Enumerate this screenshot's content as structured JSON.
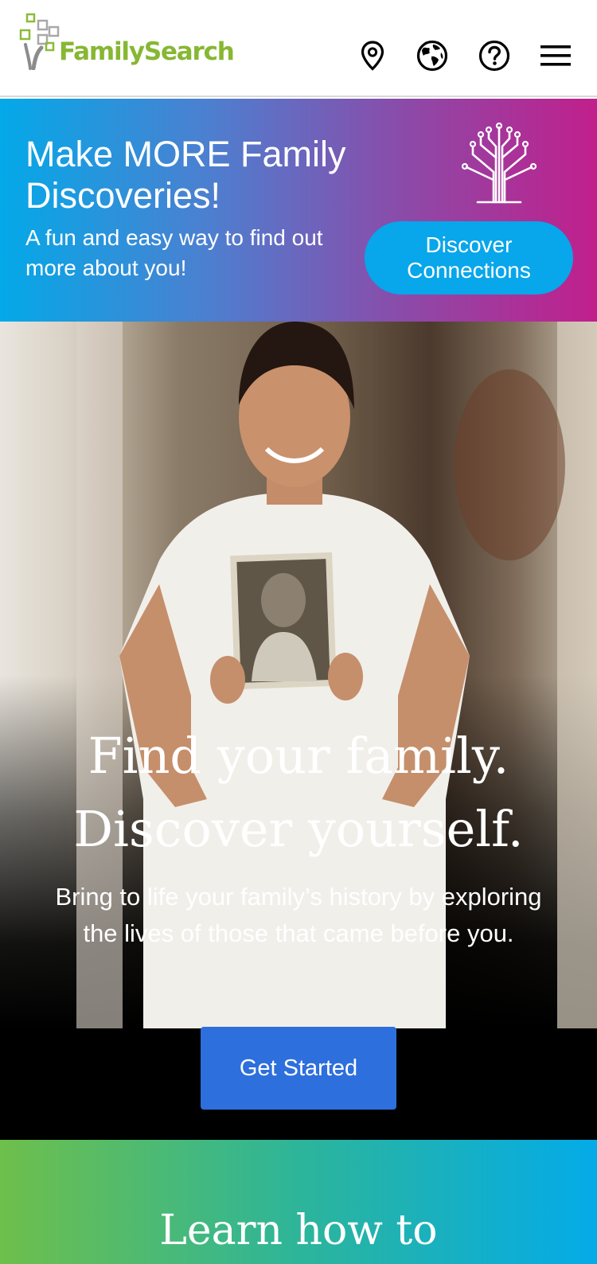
{
  "header": {
    "brand_name": "FamilySearch",
    "logo_icon": "familysearch-tree-logo",
    "icons": [
      "location-pin-icon",
      "globe-icon",
      "help-icon",
      "menu-icon"
    ]
  },
  "promo": {
    "title": "Make MORE Family Discoveries!",
    "subtitle": "A fun and easy way to find out more about you!",
    "button_label": "Discover Connections",
    "icon": "tree-branch-icon"
  },
  "hero": {
    "title_line1": "Find your family.",
    "title_line2": "Discover yourself.",
    "subtitle": "Bring to life your family’s history by exploring the lives of those that came before you.",
    "button_label": "Get Started"
  },
  "learn": {
    "title": "Learn how to"
  },
  "colors": {
    "brand_green": "#87b733",
    "primary_button": "#2d6fdc",
    "promo_button": "#08a6ea"
  }
}
